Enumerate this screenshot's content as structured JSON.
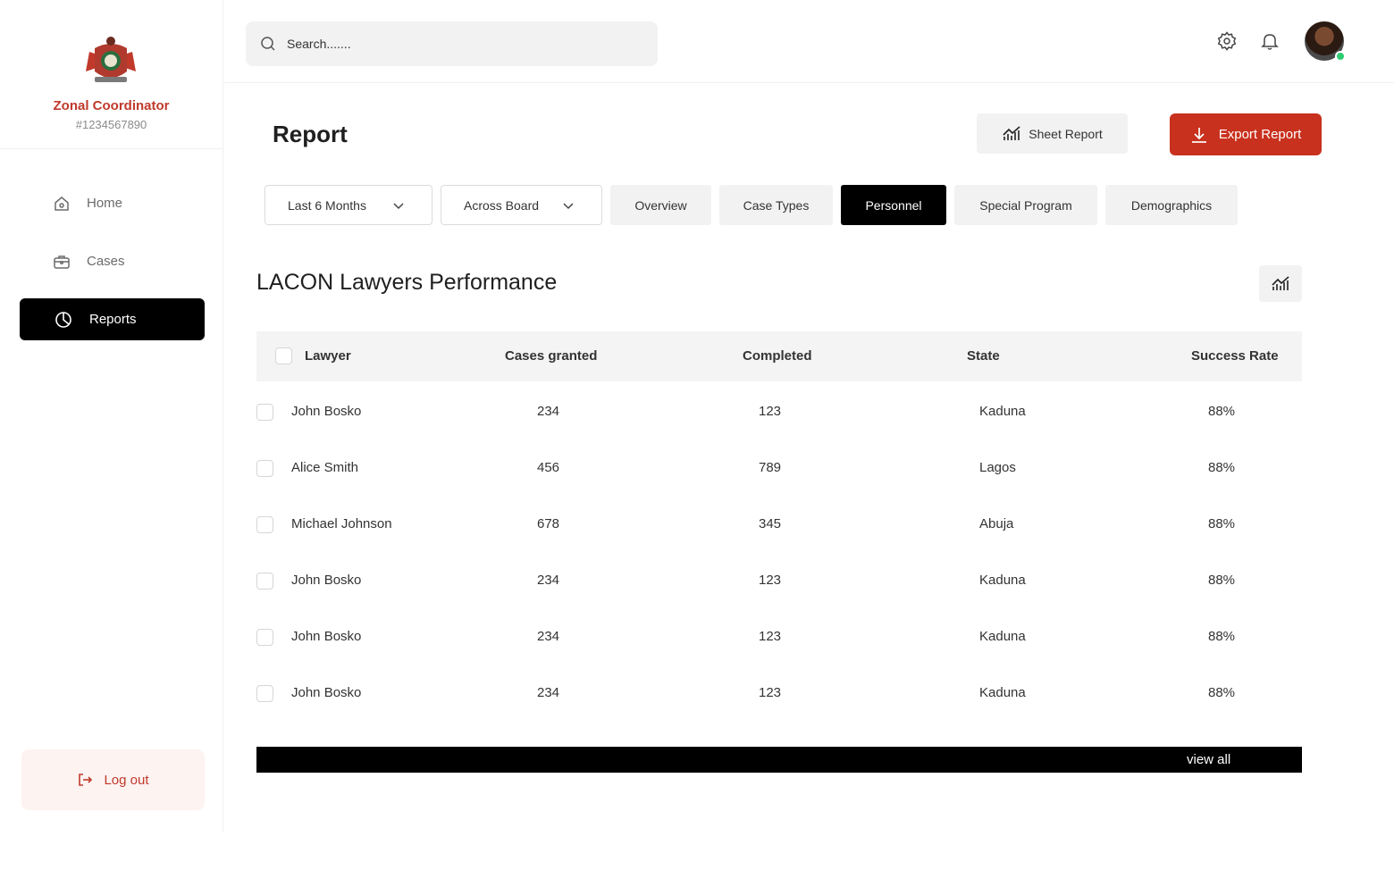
{
  "sidebar": {
    "role": "Zonal Coordinator",
    "id": "#1234567890",
    "nav": [
      {
        "label": "Home",
        "icon": "home-icon"
      },
      {
        "label": "Cases",
        "icon": "briefcase-icon"
      },
      {
        "label": "Reports",
        "icon": "pie-chart-icon",
        "active": true
      }
    ],
    "logout_label": "Log out"
  },
  "topbar": {
    "search_placeholder": "Search......."
  },
  "header": {
    "title": "Report",
    "sheet_report_label": "Sheet Report",
    "export_report_label": "Export Report"
  },
  "filters": {
    "period": "Last 6 Months",
    "scope": "Across Board",
    "tabs": [
      {
        "label": "Overview"
      },
      {
        "label": "Case Types"
      },
      {
        "label": "Personnel",
        "active": true
      },
      {
        "label": "Special Program"
      },
      {
        "label": "Demographics"
      }
    ]
  },
  "section": {
    "title": "LACON Lawyers Performance"
  },
  "table": {
    "columns": [
      "Lawyer",
      "Cases granted",
      "Completed",
      "State",
      "Success Rate"
    ],
    "rows": [
      {
        "lawyer": "John Bosko",
        "granted": "234",
        "completed": "123",
        "state": "Kaduna",
        "rate": "88%"
      },
      {
        "lawyer": "Alice Smith",
        "granted": "456",
        "completed": "789",
        "state": "Lagos",
        "rate": "88%"
      },
      {
        "lawyer": "Michael Johnson",
        "granted": "678",
        "completed": "345",
        "state": "Abuja",
        "rate": "88%"
      },
      {
        "lawyer": "John Bosko",
        "granted": "234",
        "completed": "123",
        "state": "Kaduna",
        "rate": "88%"
      },
      {
        "lawyer": "John Bosko",
        "granted": "234",
        "completed": "123",
        "state": "Kaduna",
        "rate": "88%"
      },
      {
        "lawyer": "John Bosko",
        "granted": "234",
        "completed": "123",
        "state": "Kaduna",
        "rate": "88%"
      }
    ],
    "view_all_label": "view all"
  },
  "colors": {
    "accent": "#c8311e",
    "active_bg": "#000000",
    "online": "#2ecc71"
  }
}
